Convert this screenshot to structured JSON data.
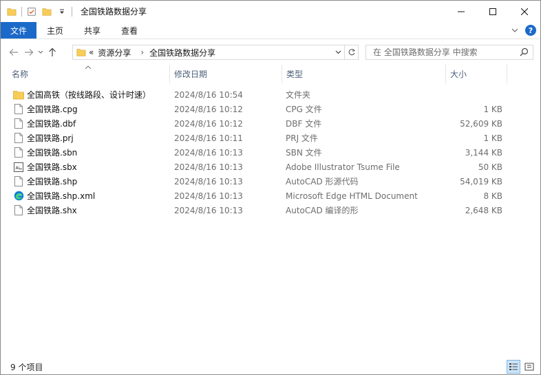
{
  "window": {
    "title": "全国铁路数据分享"
  },
  "ribbon": {
    "tabs": [
      "文件",
      "主页",
      "共享",
      "查看"
    ]
  },
  "address": {
    "overflow": "«",
    "crumbs": [
      "资源分享",
      "全国铁路数据分享"
    ]
  },
  "search": {
    "placeholder": "在 全国铁路数据分享 中搜索"
  },
  "columns": {
    "name": "名称",
    "date": "修改日期",
    "type": "类型",
    "size": "大小"
  },
  "files": [
    {
      "name": "全国高铁（按线路段、设计时速）",
      "date": "2024/8/16 10:54",
      "type": "文件夹",
      "size": "",
      "icon": "folder-icon"
    },
    {
      "name": "全国铁路.cpg",
      "date": "2024/8/16 10:12",
      "type": "CPG 文件",
      "size": "1 KB",
      "icon": "file-icon"
    },
    {
      "name": "全国铁路.dbf",
      "date": "2024/8/16 10:12",
      "type": "DBF 文件",
      "size": "52,609 KB",
      "icon": "file-icon"
    },
    {
      "name": "全国铁路.prj",
      "date": "2024/8/16 10:11",
      "type": "PRJ 文件",
      "size": "1 KB",
      "icon": "file-icon"
    },
    {
      "name": "全国铁路.sbn",
      "date": "2024/8/16 10:13",
      "type": "SBN 文件",
      "size": "3,144 KB",
      "icon": "file-icon"
    },
    {
      "name": "全国铁路.sbx",
      "date": "2024/8/16 10:13",
      "type": "Adobe Illustrator Tsume File",
      "size": "50 KB",
      "icon": "illustrator-file-icon"
    },
    {
      "name": "全国铁路.shp",
      "date": "2024/8/16 10:13",
      "type": "AutoCAD 形源代码",
      "size": "54,019 KB",
      "icon": "file-icon"
    },
    {
      "name": "全国铁路.shp.xml",
      "date": "2024/8/16 10:13",
      "type": "Microsoft Edge HTML Document",
      "size": "8 KB",
      "icon": "edge-icon"
    },
    {
      "name": "全国铁路.shx",
      "date": "2024/8/16 10:13",
      "type": "AutoCAD 编译的形",
      "size": "2,648 KB",
      "icon": "file-icon"
    }
  ],
  "status": {
    "count": "9 个项目"
  },
  "colors": {
    "accent": "#1b6ac9",
    "folder": "#f7cd58",
    "header_text": "#4c607a"
  }
}
